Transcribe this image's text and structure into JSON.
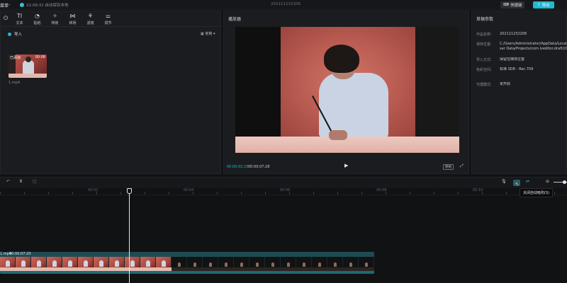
{
  "titlebar": {
    "menu_label": "菜单",
    "autosave_text": "22:09:31 自动保存本地",
    "project_name": "202111232206",
    "shortcut_label": "快捷键",
    "export_label": "导出"
  },
  "toolbar": {
    "items": [
      {
        "label": "",
        "icon": "media-icon"
      },
      {
        "label": "文本",
        "icon": "text-icon"
      },
      {
        "label": "贴纸",
        "icon": "sticker-icon"
      },
      {
        "label": "特效",
        "icon": "effects-icon"
      },
      {
        "label": "转场",
        "icon": "transition-icon"
      },
      {
        "label": "滤镜",
        "icon": "filter-icon"
      },
      {
        "label": "调节",
        "icon": "adjust-icon"
      }
    ]
  },
  "media": {
    "import_tab": "导入",
    "view_toggle": "宫格",
    "clip": {
      "badge": "已添加",
      "duration": "00:08",
      "name": "1.mp4"
    }
  },
  "player": {
    "title": "播放器",
    "current_time": "00:00:02:25",
    "total_time": "00:00:07:28",
    "ratio_label": "原始"
  },
  "properties": {
    "title": "草稿参数",
    "rows": [
      {
        "key": "作品名称:",
        "value": "202111232206"
      },
      {
        "key": "保存位置:",
        "value": "C:/Users/Administrator/AppData/Local/",
        "value2": "ser Data/Projects/com.lveditor.draft/20"
      },
      {
        "key": "导入方式:",
        "value": "保留在媒体位置"
      },
      {
        "key": "色彩空间:",
        "value": "标准 SDR - Rec.709"
      },
      {
        "key": "代理模式:",
        "value": "未开启"
      }
    ]
  },
  "timeline": {
    "tooltip": "关闭自动吸附(S)",
    "ruler_labels": [
      "00:02",
      "00:04",
      "00:06",
      "00:08",
      "00:10"
    ],
    "track": {
      "name": "1.mp4",
      "duration": "00:00:07:20"
    }
  },
  "colors": {
    "accent": "#22b8cf",
    "panel_bg": "#1b1c1f",
    "app_bg": "#111214"
  }
}
